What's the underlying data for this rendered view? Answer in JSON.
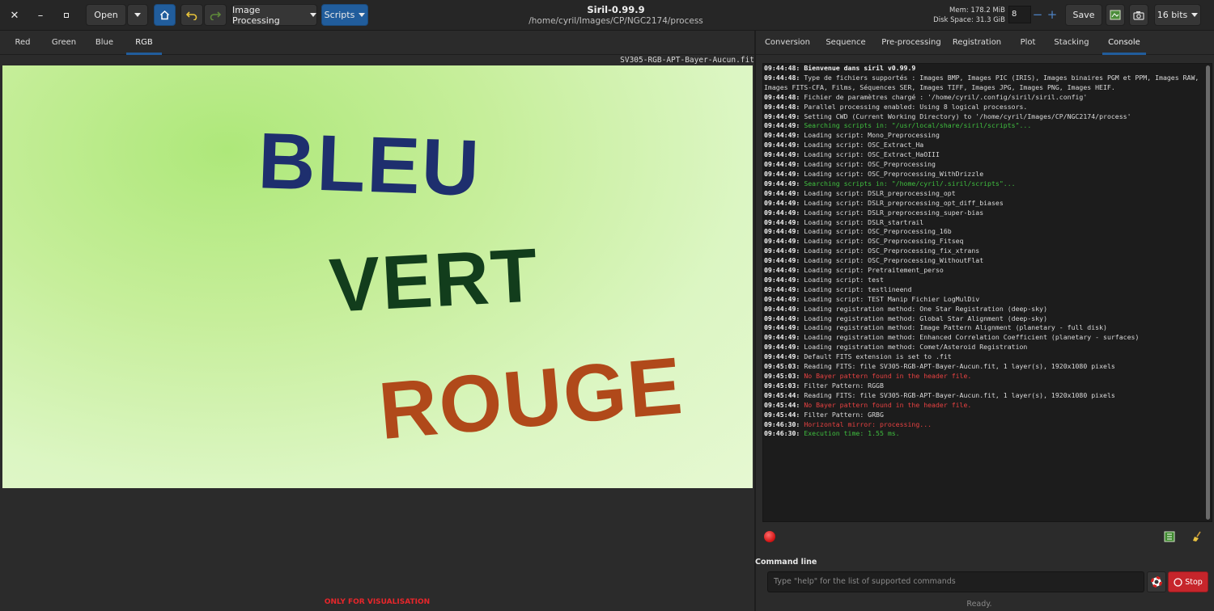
{
  "window": {
    "title": "Siril-0.99.9",
    "path": "/home/cyril/Images/CP/NGC2174/process",
    "close_glyph": "✕",
    "minimize_glyph": "–",
    "maximize_glyph": "▫"
  },
  "toolbar": {
    "open_label": "Open",
    "image_processing_label": "Image Processing",
    "scripts_label": "Scripts",
    "mem_label": "Mem: 178.2  MiB",
    "disk_label": "Disk Space: 31.3  GiB",
    "thread_count": "8",
    "minus_glyph": "−",
    "plus_glyph": "+",
    "save_label": "Save",
    "bit_depth_label": "16 bits",
    "accent_color": "#215d9c"
  },
  "left_panel": {
    "tabs": [
      {
        "label": "Red"
      },
      {
        "label": "Green"
      },
      {
        "label": "Blue"
      },
      {
        "label": "RGB",
        "active": true
      }
    ],
    "filename": "SV305-RGB-APT-Bayer-Aucun.fit",
    "image_words": [
      {
        "text": "BLEU",
        "color": "#1e2f6e"
      },
      {
        "text": "VERT",
        "color": "#123d1c"
      },
      {
        "text": "ROUGE",
        "color": "#b0491a"
      }
    ],
    "visualisation_note": "ONLY FOR VISUALISATION"
  },
  "right_panel": {
    "tabs": [
      {
        "label": "Conversion"
      },
      {
        "label": "Sequence"
      },
      {
        "label": "Pre-processing"
      },
      {
        "label": "Registration"
      },
      {
        "label": "Plot"
      },
      {
        "label": "Stacking"
      },
      {
        "label": "Console",
        "active": true
      }
    ],
    "console_lines": [
      {
        "ts": "09:44:48:",
        "msg": "Bienvenue dans siril v0.99.9",
        "style": "bold"
      },
      {
        "ts": "09:44:48:",
        "msg": "Type de fichiers supportés : Images BMP, Images PIC (IRIS), Images binaires PGM et PPM, Images RAW, Images FITS-CFA, Films, Séquences SER, Images TIFF, Images JPG, Images PNG, Images HEIF.",
        "style": "normal"
      },
      {
        "ts": "09:44:48:",
        "msg": "Fichier de paramètres chargé : '/home/cyril/.config/siril/siril.config'",
        "style": "normal"
      },
      {
        "ts": "09:44:48:",
        "msg": "Parallel processing enabled: Using 8 logical processors.",
        "style": "normal"
      },
      {
        "ts": "09:44:49:",
        "msg": "Setting CWD (Current Working Directory) to '/home/cyril/Images/CP/NGC2174/process'",
        "style": "normal"
      },
      {
        "ts": "09:44:49:",
        "msg": "Searching scripts in: \"/usr/local/share/siril/scripts\"...",
        "style": "green"
      },
      {
        "ts": "09:44:49:",
        "msg": "Loading script: Mono_Preprocessing",
        "style": "normal"
      },
      {
        "ts": "09:44:49:",
        "msg": "Loading script: OSC_Extract_Ha",
        "style": "normal"
      },
      {
        "ts": "09:44:49:",
        "msg": "Loading script: OSC_Extract_HaOIII",
        "style": "normal"
      },
      {
        "ts": "09:44:49:",
        "msg": "Loading script: OSC_Preprocessing",
        "style": "normal"
      },
      {
        "ts": "09:44:49:",
        "msg": "Loading script: OSC_Preprocessing_WithDrizzle",
        "style": "normal"
      },
      {
        "ts": "09:44:49:",
        "msg": "Searching scripts in: \"/home/cyril/.siril/scripts\"...",
        "style": "green"
      },
      {
        "ts": "09:44:49:",
        "msg": "Loading script: DSLR_preprocessing_opt",
        "style": "normal"
      },
      {
        "ts": "09:44:49:",
        "msg": "Loading script: DSLR_preprocessing_opt_diff_biases",
        "style": "normal"
      },
      {
        "ts": "09:44:49:",
        "msg": "Loading script: DSLR_preprocessing_super-bias",
        "style": "normal"
      },
      {
        "ts": "09:44:49:",
        "msg": "Loading script: DSLR_startrail",
        "style": "normal"
      },
      {
        "ts": "09:44:49:",
        "msg": "Loading script: OSC_Preprocessing_16b",
        "style": "normal"
      },
      {
        "ts": "09:44:49:",
        "msg": "Loading script: OSC_Preprocessing_Fitseq",
        "style": "normal"
      },
      {
        "ts": "09:44:49:",
        "msg": "Loading script: OSC_Preprocessing_fix_xtrans",
        "style": "normal"
      },
      {
        "ts": "09:44:49:",
        "msg": "Loading script: OSC_Preprocessing_WithoutFlat",
        "style": "normal"
      },
      {
        "ts": "09:44:49:",
        "msg": "Loading script: Pretraitement_perso",
        "style": "normal"
      },
      {
        "ts": "09:44:49:",
        "msg": "Loading script: test",
        "style": "normal"
      },
      {
        "ts": "09:44:49:",
        "msg": "Loading script: testlineend",
        "style": "normal"
      },
      {
        "ts": "09:44:49:",
        "msg": "Loading script: TEST Manip Fichier LogMulDiv",
        "style": "normal"
      },
      {
        "ts": "09:44:49:",
        "msg": "Loading registration method: One Star Registration (deep-sky)",
        "style": "normal"
      },
      {
        "ts": "09:44:49:",
        "msg": "Loading registration method: Global Star Alignment (deep-sky)",
        "style": "normal"
      },
      {
        "ts": "09:44:49:",
        "msg": "Loading registration method: Image Pattern Alignment (planetary - full disk)",
        "style": "normal"
      },
      {
        "ts": "09:44:49:",
        "msg": "Loading registration method: Enhanced Correlation Coefficient (planetary - surfaces)",
        "style": "normal"
      },
      {
        "ts": "09:44:49:",
        "msg": "Loading registration method: Comet/Asteroid Registration",
        "style": "normal"
      },
      {
        "ts": "09:44:49:",
        "msg": "Default FITS extension is set to .fit",
        "style": "normal"
      },
      {
        "ts": "09:45:03:",
        "msg": "Reading FITS: file SV305-RGB-APT-Bayer-Aucun.fit, 1 layer(s), 1920x1080 pixels",
        "style": "normal"
      },
      {
        "ts": "09:45:03:",
        "msg": "No Bayer pattern found in the header file.",
        "style": "red"
      },
      {
        "ts": "09:45:03:",
        "msg": "Filter Pattern: RGGB",
        "style": "normal"
      },
      {
        "ts": "09:45:44:",
        "msg": "Reading FITS: file SV305-RGB-APT-Bayer-Aucun.fit, 1 layer(s), 1920x1080 pixels",
        "style": "normal"
      },
      {
        "ts": "09:45:44:",
        "msg": "No Bayer pattern found in the header file.",
        "style": "red"
      },
      {
        "ts": "09:45:44:",
        "msg": "Filter Pattern: GRBG",
        "style": "normal"
      },
      {
        "ts": "09:46:30:",
        "msg": "Horizontal mirror: processing...",
        "style": "red"
      },
      {
        "ts": "09:46:30:",
        "msg": "Execution time: 1.55 ms.",
        "style": "green"
      }
    ],
    "command_line_label": "Command line",
    "command_placeholder": "Type \"help\" for the list of supported commands",
    "stop_label": "Stop",
    "status_text": "Ready.",
    "stop_color": "#c6252b"
  },
  "icons": {
    "home": "home-icon",
    "undo": "undo-icon",
    "redo": "redo-icon",
    "image_panel": "image-panel-icon",
    "snapshot": "snapshot-icon",
    "save_log": "save-log-icon",
    "clear_log": "broom-icon",
    "help": "lifebuoy-icon",
    "status": "status-indicator-icon"
  }
}
